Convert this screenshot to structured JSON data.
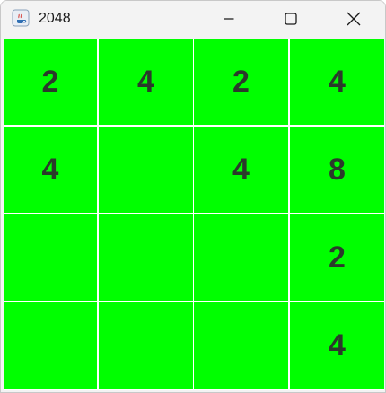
{
  "window": {
    "title": "2048",
    "icon": "java-cup-icon"
  },
  "colors": {
    "tile": "#00ff00",
    "tile_text": "#2b3a2b",
    "grid_line": "#ffffff",
    "titlebar": "#f3f3f3"
  },
  "board": {
    "rows": [
      [
        "2",
        "4",
        "2",
        "4"
      ],
      [
        "4",
        "",
        "4",
        "8"
      ],
      [
        "",
        "",
        "",
        "2"
      ],
      [
        "",
        "",
        "",
        "4"
      ]
    ]
  }
}
